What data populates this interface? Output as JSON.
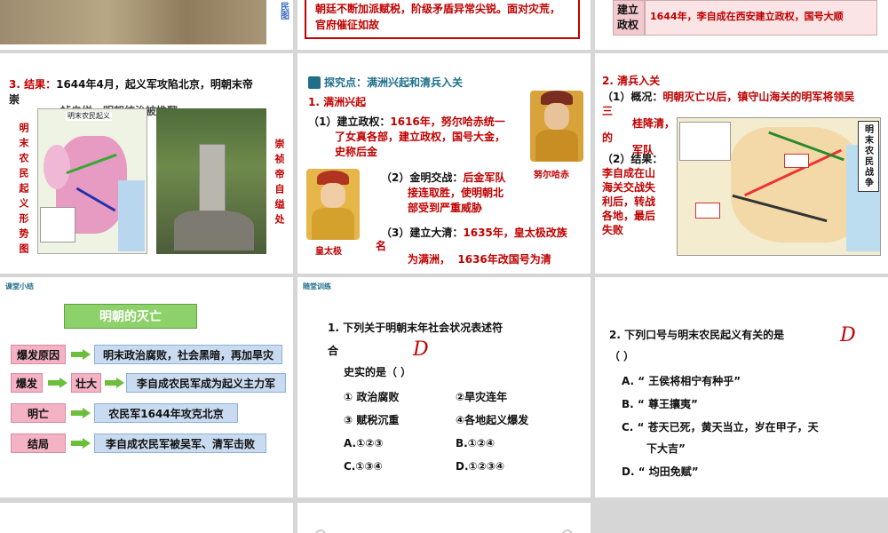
{
  "top_left": {
    "vertical_label": "民图"
  },
  "top_center": {
    "line1": "朝廷不断加派赋税，阶级矛盾异常尖锐。面对灾荒，",
    "line2": "官府催征如故"
  },
  "top_right": {
    "cell_label_1": "建立",
    "cell_label_2": "政权",
    "cell_text": "1644年，李自成在西安建立政权，国号大顺"
  },
  "mid_left": {
    "result_label": "3. 结果：",
    "result_text_1": "1644年4月，起义军攻陷北京，明朝末帝",
    "result_text_2": "崇",
    "overlap_text": "祯自缢，明朝统治被推翻",
    "map_title": "明末农民起义",
    "left_caption": "明末农民起义形势图",
    "right_caption": "崇祯帝自缢处"
  },
  "mid_center": {
    "header": "探究点：满洲兴起和清兵入关",
    "section": "1. 满洲兴起",
    "item1_label": "（1）",
    "item1_1": "建立政权：",
    "item1_2": "1616年，努尔哈赤统一",
    "item1_3": "了女真各部，建立政权，国号大金，",
    "item1_4": "史称后金",
    "item2_label": "（2）",
    "item2_1": "金明交战：",
    "item2_2": "后金军队",
    "item2_3": "接连取胜，使明朝北",
    "item2_4": "部受到严重威胁",
    "item3_label": "（3）",
    "item3_1": "建立大清：",
    "item3_2": "1635年，皇太极改族",
    "item3_3": "名",
    "item3_4": "为满洲，",
    "item3_5": "1636年改国号为清",
    "portrait1_caption": "努尔哈赤",
    "portrait2_caption": "皇太极"
  },
  "mid_right": {
    "heading": "2. 清兵入关",
    "p1_label": "（1）概况：",
    "p1_text_1": "明朝灭亡以后，镇守山海关的明军将领吴",
    "p1_text_2": "三",
    "p1_text_3": "桂降清，",
    "p1_text_4": "的",
    "p1_text_5": "军队",
    "p2_label": "（2）结果：",
    "p2_lines": [
      "李自成在山",
      "海关交战失",
      "利后，转战",
      "各地，最后",
      "失败"
    ],
    "map_title": "明末农民战争"
  },
  "bottom_left": {
    "small_title": "课堂小结",
    "main_title": "明朝的灭亡",
    "rows": [
      {
        "label": "爆发原因",
        "text": "明末政治腐败，社会黑暗，再加旱灾"
      },
      {
        "label": "爆发",
        "label2": "壮大",
        "text": "李自成农民军成为起义主力军"
      },
      {
        "label": "明亡",
        "text": "农民军1644年攻克北京"
      },
      {
        "label": "结局",
        "text": "李自成农民军被吴军、清军击败"
      }
    ]
  },
  "bottom_center": {
    "small_title": "随堂训练",
    "question_1": "1. 下列关于明朝末年社会状况表述符",
    "question_2": "合",
    "question_3": "史实的是（        ）",
    "answer": "D",
    "opt1": "① 政治腐败",
    "opt2": "②旱灾连年",
    "opt3": "③ 赋税沉重",
    "opt4": "④各地起义爆发",
    "choiceA": "A.①②③",
    "choiceB": "B.①②④",
    "choiceC": "C.①③④",
    "choiceD": "D.①②③④"
  },
  "bottom_right": {
    "question_1": "2. 下列口号与明末农民起义有关的是",
    "question_2": "（        ）",
    "answer": "D",
    "optA": "A. “ 王侯将相宁有种乎”",
    "optB": "B. “ 尊王攘夷”",
    "optC1": "C. “ 苍天已死，黄天当立，岁在甲子，天",
    "optC2": "下大吉”",
    "optD": "D. “ 均田免赋”"
  }
}
